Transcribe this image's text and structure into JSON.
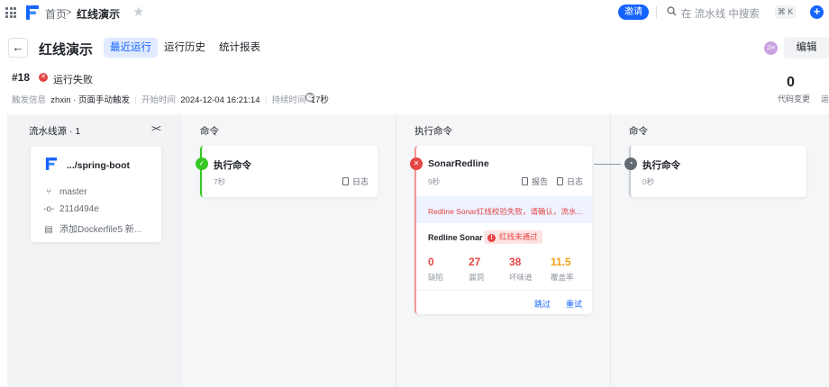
{
  "topbar": {
    "breadcrumb_home": "首页",
    "breadcrumb_sep": ">",
    "breadcrumb_current": "红线演示",
    "invite_label": "邀请",
    "search_placeholder": "在 流水线 中搜索",
    "shortcut": "⌘ K",
    "plus": "+"
  },
  "header": {
    "back": "←",
    "title": "红线演示",
    "tabs": [
      "最近运行",
      "运行历史",
      "统计报表"
    ],
    "avatar_initials": "ZH",
    "edit_label": "编辑"
  },
  "run": {
    "number": "#18",
    "status_text": "运行失败",
    "trigger_label": "触发信息",
    "trigger_user": "zhxin",
    "trigger_mode": "页面手动触发",
    "start_label": "开始时间",
    "start_time": "2024-12-04 16:21:14",
    "duration_label": "持续时间",
    "duration": "17秒",
    "code_changes": "0",
    "code_changes_label": "代码变更",
    "cut_label": "运"
  },
  "source": {
    "column_title": "流水线源 · 1",
    "collapse": "><",
    "repo": ".../spring-boot",
    "branch": "master",
    "commit": "211d494e",
    "message": "添加Dockerfile5 新..."
  },
  "stages": [
    {
      "title": "命令",
      "job": "执行命令",
      "time": "7秒",
      "log_label": "日志",
      "status": "success"
    },
    {
      "title": "执行命令",
      "job": "SonarRedline",
      "time": "9秒",
      "report_label": "报告",
      "log_label": "日志",
      "status": "failed",
      "error": "Redline Sonar红线校验失败，请确认，流水...",
      "redline_label": "Redline Sonar",
      "redline_badge": "红线未通过",
      "metrics": [
        {
          "value": "0",
          "label": "缺陷"
        },
        {
          "value": "27",
          "label": "漏洞"
        },
        {
          "value": "38",
          "label": "坏味道"
        },
        {
          "value": "11.5",
          "label": "覆盖率"
        }
      ],
      "skip_label": "跳过",
      "retry_label": "重试"
    },
    {
      "title": "命令",
      "job": "执行命令",
      "time": "0秒",
      "log_label": "日志",
      "status": "waiting"
    }
  ],
  "colors": {
    "accent": "#1664ff",
    "success": "#34c724",
    "error": "#e54545",
    "warning": "#f2a218"
  }
}
